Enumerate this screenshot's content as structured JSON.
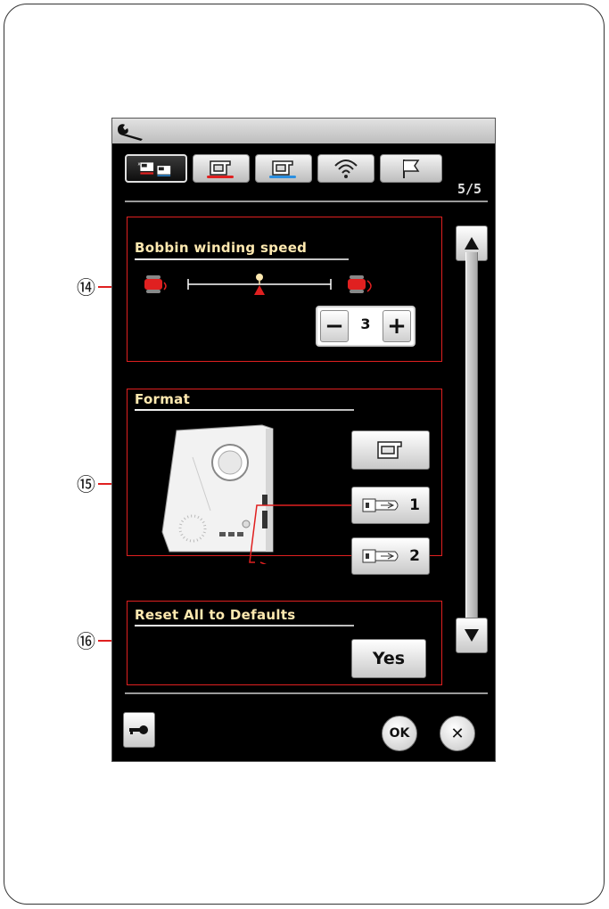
{
  "header": {
    "page_indicator": "5/5"
  },
  "tabs": [
    {
      "name": "machine-settings",
      "icon": "machine-settings-icon"
    },
    {
      "name": "sewing-settings",
      "icon": "sewing-machine-red-icon"
    },
    {
      "name": "embroidery-settings",
      "icon": "sewing-machine-blue-icon"
    },
    {
      "name": "wireless",
      "icon": "wireless-icon"
    },
    {
      "name": "language",
      "icon": "flag-icon"
    }
  ],
  "bobbin_speed": {
    "title": "Bobbin winding speed",
    "value": "3",
    "minus": "−",
    "plus": "+",
    "level_fraction": 0.5
  },
  "format": {
    "title": "Format",
    "usb1_label": "1",
    "usb2_label": "2"
  },
  "reset": {
    "title": "Reset All to Defaults",
    "yes_label": "Yes"
  },
  "footer": {
    "ok_label": "OK",
    "cancel_label": "✕"
  },
  "callouts": {
    "c14": "⑭",
    "c15": "⑮",
    "c16": "⑯"
  },
  "colors": {
    "section_border": "#e02020",
    "title_text": "#ffe9b0"
  }
}
